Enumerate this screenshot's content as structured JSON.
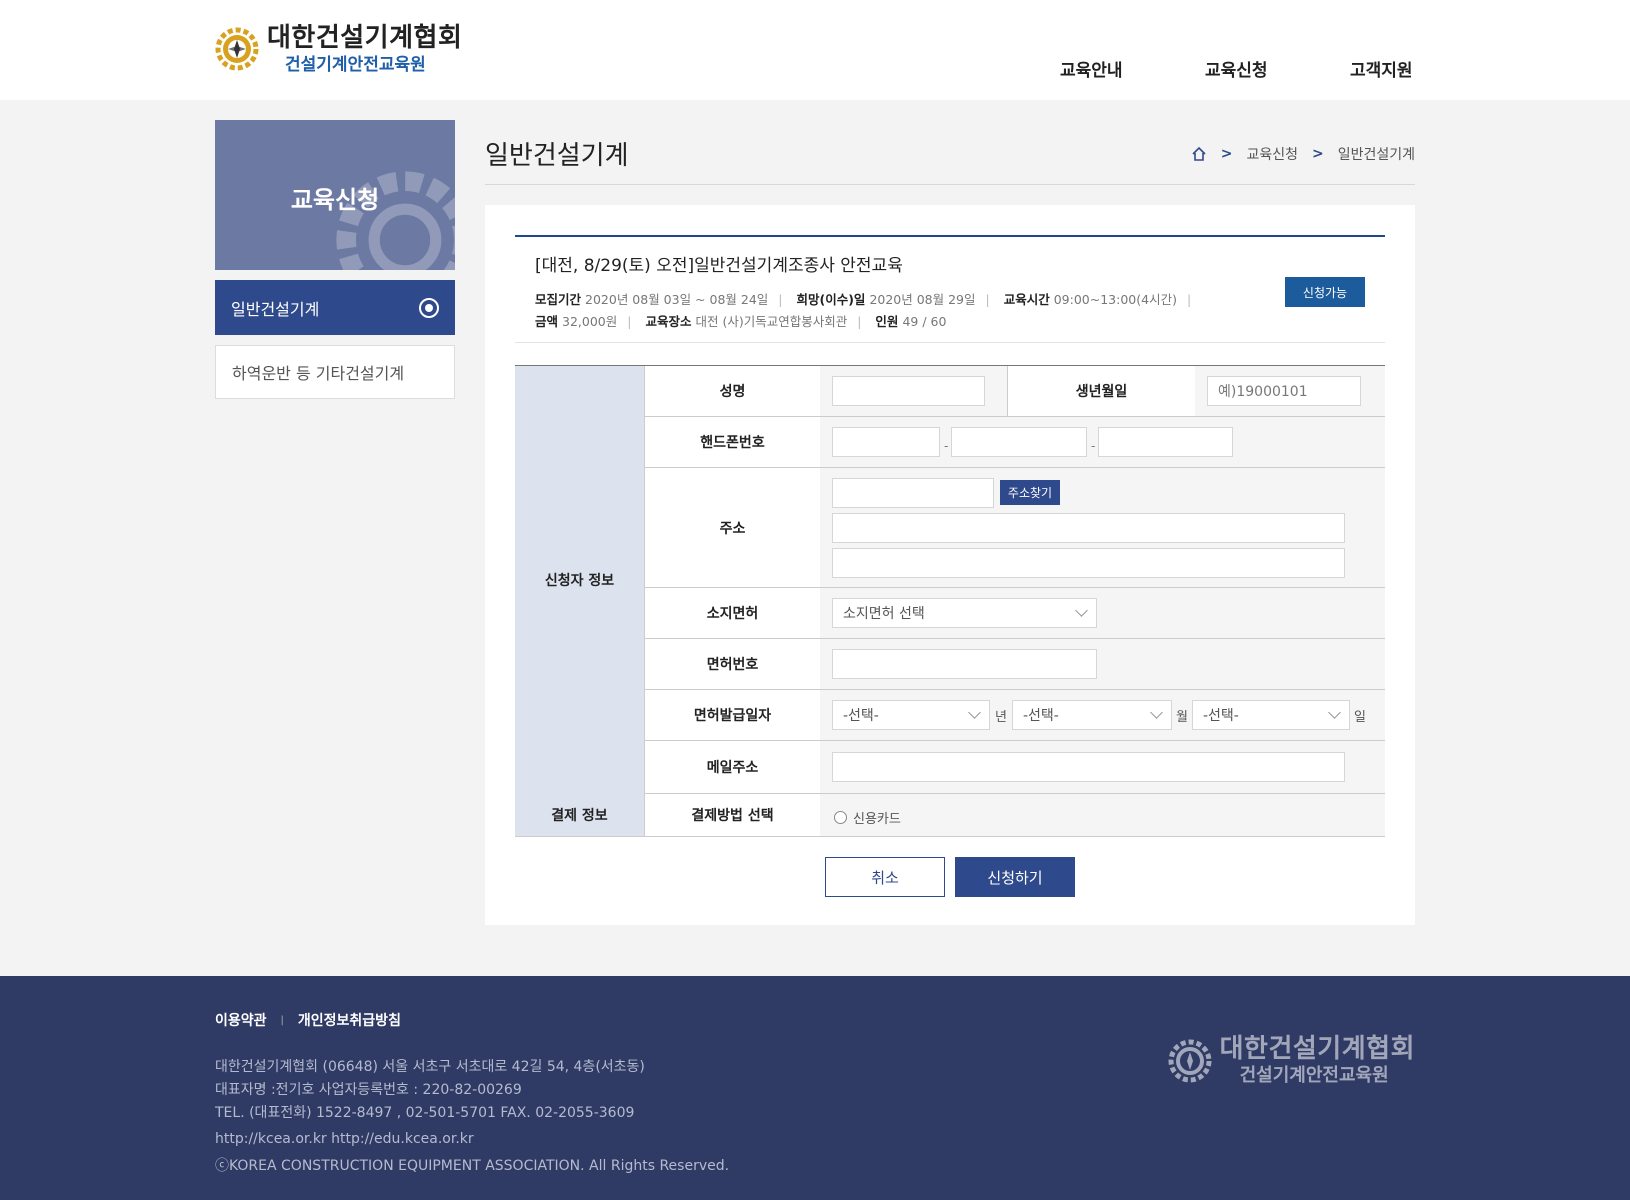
{
  "brand": {
    "title": "대한건설기계협회",
    "subtitle": "건설기계안전교육원"
  },
  "nav": [
    "교육안내",
    "교육신청",
    "고객지원"
  ],
  "sidebar": {
    "hero_title": "교육신청",
    "items": [
      {
        "label": "일반건설기계",
        "active": true
      },
      {
        "label": "하역운반 등 기타건설기계",
        "active": false
      }
    ]
  },
  "page": {
    "title": "일반건설기계",
    "breadcrumb": [
      "교육신청",
      "일반건설기계"
    ]
  },
  "course": {
    "title": "[대전, 8/29(토) 오전]일반건설기계조종사 안전교육",
    "recruit_label": "모집기간",
    "recruit_value": "2020년 08월 03일 ~ 08월 24일",
    "wish_label": "희망(이수)일",
    "wish_value": "2020년 08월 29일",
    "time_label": "교육시간",
    "time_value": "09:00~13:00(4시간)",
    "fee_label": "금액",
    "fee_value": "32,000원",
    "place_label": "교육장소",
    "place_value": "대전 (사)기독교연합봉사회관",
    "people_label": "인원",
    "people_value": "49 / 60",
    "status": "신청가능"
  },
  "form": {
    "group_applicant": "신청자 정보",
    "group_payment": "결제 정보",
    "name_label": "성명",
    "birth_label": "생년월일",
    "birth_placeholder": "예)19000101",
    "phone_label": "핸드폰번호",
    "phone_sep": "-",
    "address_label": "주소",
    "address_button": "주소찾기",
    "license_label": "소지면허",
    "license_select": "소지면허 선택",
    "license_no_label": "면허번호",
    "issue_label": "면허발급일자",
    "issue_year": "-선택-",
    "issue_month": "-선택-",
    "issue_day": "-선택-",
    "unit_year": "년",
    "unit_month": "월",
    "unit_day": "일",
    "email_label": "메일주소",
    "pay_label": "결제방법 선택",
    "pay_option": "신용카드"
  },
  "buttons": {
    "cancel": "취소",
    "submit": "신청하기"
  },
  "footer": {
    "links": [
      "이용약관",
      "개인정보취급방침"
    ],
    "address": "대한건설기계협회  (06648) 서울 서초구 서초대로 42길 54, 4층(서초동)",
    "rep": "대표자명 :전기호  사업자등록번호 : 220-82-00269",
    "tel": "TEL. (대표전화) 1522-8497 , 02-501-5701   FAX. 02-2055-3609",
    "urls": "http://kcea.or.kr    http://edu.kcea.or.kr",
    "copyright": "ⓒKOREA CONSTRUCTION EQUIPMENT ASSOCIATION. All Rights Reserved."
  },
  "colors": {
    "navy": "#2f4a8c",
    "footer": "#2f3a65",
    "badge": "#1d5c9c",
    "logo_gold": "#d8a21f"
  }
}
